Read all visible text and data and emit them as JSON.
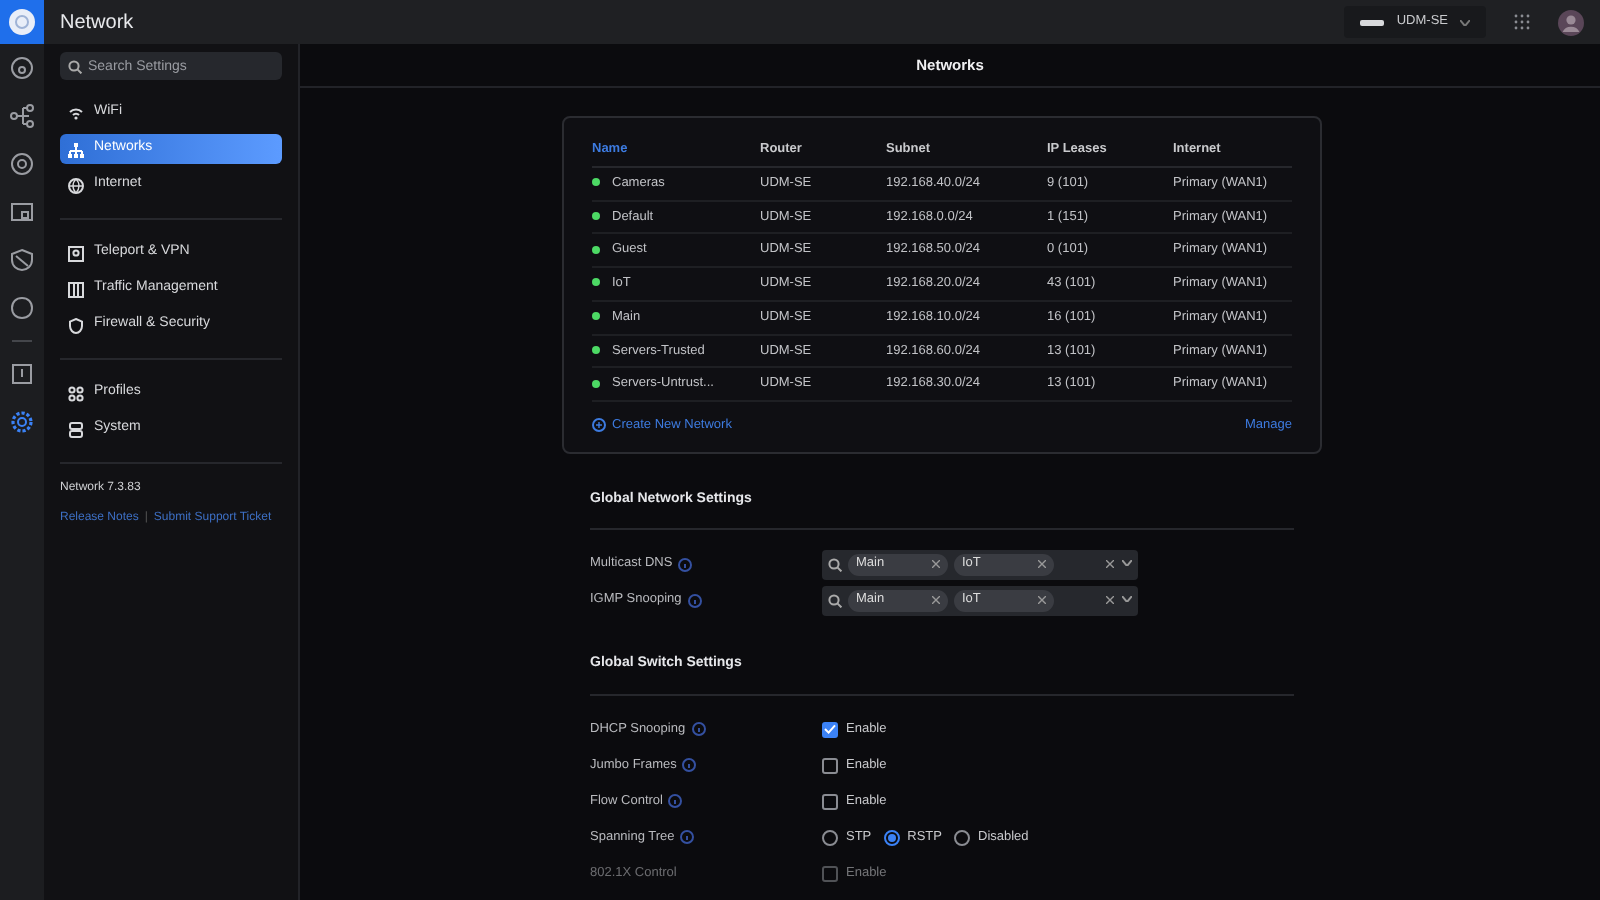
{
  "app": {
    "title": "Network"
  },
  "rail": {
    "top": [
      {
        "kind": "dashboard",
        "selected": false
      },
      {
        "kind": "topology",
        "selected": false
      },
      {
        "kind": "devices",
        "selected": false
      },
      {
        "kind": "clients",
        "selected": false
      },
      {
        "kind": "shield",
        "selected": false
      },
      {
        "kind": "circle",
        "selected": false
      }
    ],
    "bottom": [
      {
        "kind": "alerts",
        "selected": false
      },
      {
        "kind": "settings",
        "selected": true
      }
    ]
  },
  "header": {
    "device": "UDM-SE"
  },
  "sidebar": {
    "search": {
      "placeholder": "Search Settings"
    },
    "groups": [
      [
        {
          "kind": "wifi",
          "label": "WiFi",
          "selected": false
        },
        {
          "kind": "networks",
          "label": "Networks",
          "selected": true
        },
        {
          "kind": "internet",
          "label": "Internet",
          "selected": false
        }
      ],
      [
        {
          "kind": "vpn",
          "label": "Teleport & VPN",
          "selected": false
        },
        {
          "kind": "traffic",
          "label": "Traffic Management",
          "selected": false
        },
        {
          "kind": "firewall",
          "label": "Firewall & Security",
          "selected": false
        }
      ],
      [
        {
          "kind": "profiles",
          "label": "Profiles",
          "selected": false
        },
        {
          "kind": "system",
          "label": "System",
          "selected": false
        }
      ]
    ],
    "version": "Network 7.3.83",
    "links": [
      "Release Notes",
      "Submit Support Ticket"
    ],
    "link_separator": "|"
  },
  "page_title": "Networks",
  "networks": {
    "columns": [
      {
        "label": "Name",
        "selected": true
      },
      {
        "label": "Router",
        "selected": false
      },
      {
        "label": "Subnet",
        "selected": false
      },
      {
        "label": "IP Leases",
        "selected": false
      },
      {
        "label": "Internet",
        "selected": false
      }
    ],
    "rows": [
      {
        "color": "#4cd964",
        "cells": [
          "Cameras",
          "UDM-SE",
          "192.168.40.0/24",
          "9 (101)",
          "Primary (WAN1)"
        ]
      },
      {
        "color": "#4cd964",
        "cells": [
          "Default",
          "UDM-SE",
          "192.168.0.0/24",
          "1 (151)",
          "Primary (WAN1)"
        ]
      },
      {
        "color": "#4cd964",
        "cells": [
          "Guest",
          "UDM-SE",
          "192.168.50.0/24",
          "0 (101)",
          "Primary (WAN1)"
        ]
      },
      {
        "color": "#4cd964",
        "cells": [
          "IoT",
          "UDM-SE",
          "192.168.20.0/24",
          "43 (101)",
          "Primary (WAN1)"
        ]
      },
      {
        "color": "#4cd964",
        "cells": [
          "Main",
          "UDM-SE",
          "192.168.10.0/24",
          "16 (101)",
          "Primary (WAN1)"
        ]
      },
      {
        "color": "#4cd964",
        "cells": [
          "Servers-Trusted",
          "UDM-SE",
          "192.168.60.0/24",
          "13 (101)",
          "Primary (WAN1)"
        ]
      },
      {
        "color": "#4cd964",
        "cells": [
          "Servers-Untrust...",
          "UDM-SE",
          "192.168.30.0/24",
          "13 (101)",
          "Primary (WAN1)"
        ]
      }
    ],
    "create": "Create New Network",
    "manage": "Manage"
  },
  "sections": [
    {
      "title": "Global Network Settings",
      "rows": [
        {
          "kind": "multiselect",
          "label": "Multicast DNS",
          "tags": [
            "Main",
            "IoT"
          ]
        },
        {
          "kind": "multiselect",
          "label": "IGMP Snooping",
          "tags": [
            "Main",
            "IoT"
          ]
        }
      ]
    },
    {
      "title": "Global Switch Settings",
      "rows": [
        {
          "kind": "checkbox",
          "label": "DHCP Snooping",
          "option": "Enable",
          "checked": true,
          "disabled": false
        },
        {
          "kind": "checkbox",
          "label": "Jumbo Frames",
          "option": "Enable",
          "checked": false,
          "disabled": false
        },
        {
          "kind": "checkbox",
          "label": "Flow Control",
          "option": "Enable",
          "checked": false,
          "disabled": false
        },
        {
          "kind": "radio",
          "label": "Spanning Tree",
          "options": [
            {
              "label": "STP",
              "selected": false
            },
            {
              "label": "RSTP",
              "selected": true
            },
            {
              "label": "Disabled",
              "selected": false
            }
          ]
        },
        {
          "kind": "checkbox",
          "label": "802.1X Control",
          "option": "Enable",
          "checked": false,
          "disabled": true
        }
      ]
    }
  ]
}
